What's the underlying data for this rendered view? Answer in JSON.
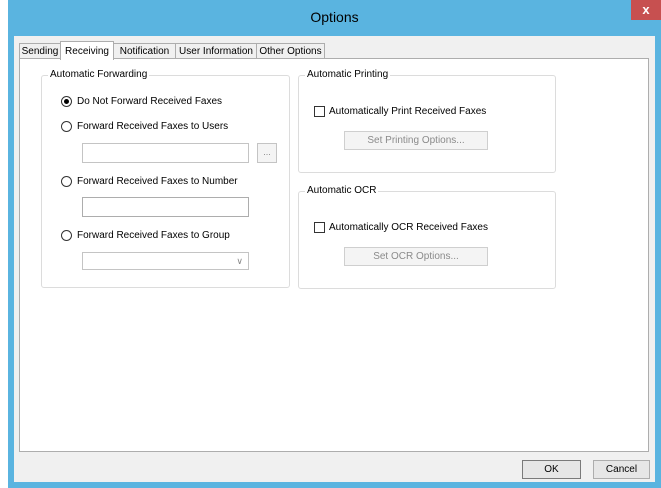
{
  "window": {
    "title": "Options",
    "close_glyph": "x"
  },
  "tabs": [
    {
      "label": "Sending",
      "active": false
    },
    {
      "label": "Receiving",
      "active": true
    },
    {
      "label": "Notification",
      "active": false
    },
    {
      "label": "User Information",
      "active": false
    },
    {
      "label": "Other Options",
      "active": false
    }
  ],
  "forwarding": {
    "group_label": "Automatic Forwarding",
    "options": [
      {
        "label": "Do Not Forward Received Faxes",
        "selected": true
      },
      {
        "label": "Forward Received Faxes to Users",
        "selected": false
      },
      {
        "label": "Forward Received Faxes to Number",
        "selected": false
      },
      {
        "label": "Forward Received Faxes to Group",
        "selected": false
      }
    ],
    "users_value": "",
    "browse_label": "...",
    "number_value": "",
    "group_value": ""
  },
  "printing": {
    "group_label": "Automatic Printing",
    "checkbox_label": "Automatically Print Received Faxes",
    "checked": false,
    "button_label": "Set Printing Options..."
  },
  "ocr": {
    "group_label": "Automatic OCR",
    "checkbox_label": "Automatically OCR Received Faxes",
    "checked": false,
    "button_label": "Set OCR Options..."
  },
  "footer": {
    "ok_label": "OK",
    "cancel_label": "Cancel"
  }
}
